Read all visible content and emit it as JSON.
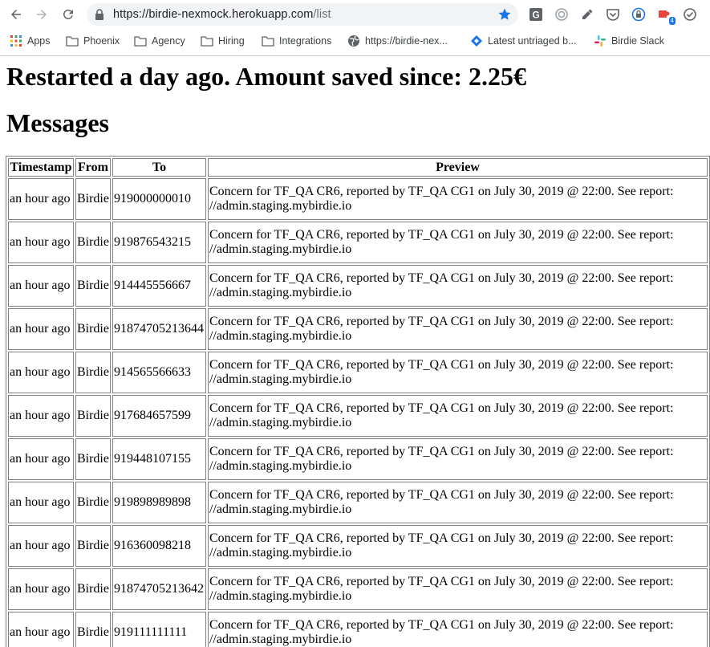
{
  "browser": {
    "url_host": "https://birdie-nexmock.herokuapp.com",
    "url_path": "/list",
    "extension_badge": "4",
    "bookmarks": [
      {
        "label": "Apps",
        "icon": "apps-grid-icon"
      },
      {
        "label": "Phoenix",
        "icon": "folder-icon"
      },
      {
        "label": "Agency",
        "icon": "folder-icon"
      },
      {
        "label": "Hiring",
        "icon": "folder-icon"
      },
      {
        "label": "Integrations",
        "icon": "folder-icon"
      },
      {
        "label": "https://birdie-nex...",
        "icon": "globe-icon"
      },
      {
        "label": "Latest untriaged b...",
        "icon": "diamond-icon"
      },
      {
        "label": "Birdie Slack",
        "icon": "slack-icon"
      }
    ]
  },
  "page": {
    "saved_heading": "Restarted a day ago. Amount saved since: 2.25€",
    "messages_heading": "Messages",
    "table": {
      "headers": [
        "Timestamp",
        "From",
        "To",
        "Preview"
      ],
      "rows": [
        {
          "timestamp": "an hour ago",
          "from": "Birdie",
          "to": "919000000010",
          "preview": "Concern for TF_QA CR6, reported by TF_QA CG1 on July 30, 2019 @ 22:00. See report: //admin.staging.mybirdie.io"
        },
        {
          "timestamp": "an hour ago",
          "from": "Birdie",
          "to": "919876543215",
          "preview": "Concern for TF_QA CR6, reported by TF_QA CG1 on July 30, 2019 @ 22:00. See report: //admin.staging.mybirdie.io"
        },
        {
          "timestamp": "an hour ago",
          "from": "Birdie",
          "to": "914445556667",
          "preview": "Concern for TF_QA CR6, reported by TF_QA CG1 on July 30, 2019 @ 22:00. See report: //admin.staging.mybirdie.io"
        },
        {
          "timestamp": "an hour ago",
          "from": "Birdie",
          "to": "91874705213644",
          "preview": "Concern for TF_QA CR6, reported by TF_QA CG1 on July 30, 2019 @ 22:00. See report: //admin.staging.mybirdie.io"
        },
        {
          "timestamp": "an hour ago",
          "from": "Birdie",
          "to": "914565566633",
          "preview": "Concern for TF_QA CR6, reported by TF_QA CG1 on July 30, 2019 @ 22:00. See report: //admin.staging.mybirdie.io"
        },
        {
          "timestamp": "an hour ago",
          "from": "Birdie",
          "to": "917684657599",
          "preview": "Concern for TF_QA CR6, reported by TF_QA CG1 on July 30, 2019 @ 22:00. See report: //admin.staging.mybirdie.io"
        },
        {
          "timestamp": "an hour ago",
          "from": "Birdie",
          "to": "919448107155",
          "preview": "Concern for TF_QA CR6, reported by TF_QA CG1 on July 30, 2019 @ 22:00. See report: //admin.staging.mybirdie.io"
        },
        {
          "timestamp": "an hour ago",
          "from": "Birdie",
          "to": "919898989898",
          "preview": "Concern for TF_QA CR6, reported by TF_QA CG1 on July 30, 2019 @ 22:00. See report: //admin.staging.mybirdie.io"
        },
        {
          "timestamp": "an hour ago",
          "from": "Birdie",
          "to": "916360098218",
          "preview": "Concern for TF_QA CR6, reported by TF_QA CG1 on July 30, 2019 @ 22:00. See report: //admin.staging.mybirdie.io"
        },
        {
          "timestamp": "an hour ago",
          "from": "Birdie",
          "to": "91874705213642",
          "preview": "Concern for TF_QA CR6, reported by TF_QA CG1 on July 30, 2019 @ 22:00. See report: //admin.staging.mybirdie.io"
        },
        {
          "timestamp": "an hour ago",
          "from": "Birdie",
          "to": "919111111111",
          "preview": "Concern for TF_QA CR6, reported by TF_QA CG1 on July 30, 2019 @ 22:00. See report: //admin.staging.mybirdie.io"
        }
      ]
    }
  },
  "colors": {
    "accent_star": "#1a73e8",
    "omnibox_bg": "#f1f3f4",
    "table_border": "#808080"
  }
}
